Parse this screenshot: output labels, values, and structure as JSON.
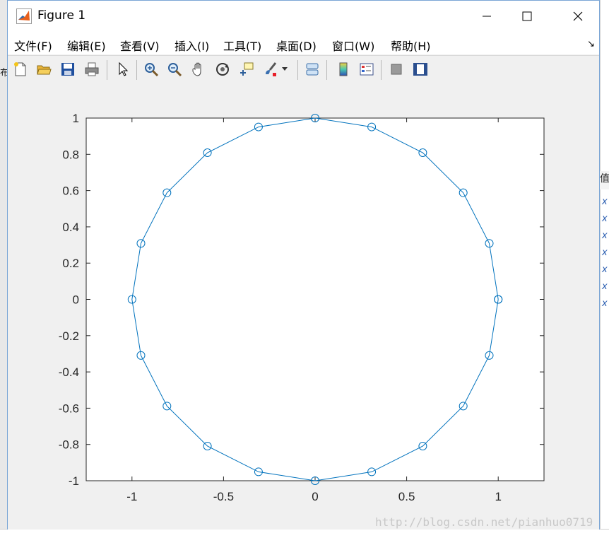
{
  "window": {
    "title": "Figure 1",
    "controls": {
      "minimize_icon": "minimize-icon",
      "maximize_icon": "maximize-icon",
      "close_icon": "close-icon"
    }
  },
  "menu": {
    "items": [
      "文件(F)",
      "编辑(E)",
      "查看(V)",
      "插入(I)",
      "工具(T)",
      "桌面(D)",
      "窗口(W)",
      "帮助(H)"
    ],
    "arrow": "↘"
  },
  "toolbar": {
    "buttons": [
      "new-figure-icon",
      "open-file-icon",
      "save-icon",
      "print-icon",
      "pointer-icon",
      "zoom-in-icon",
      "zoom-out-icon",
      "pan-icon",
      "rotate-3d-icon",
      "data-cursor-icon",
      "brush-icon",
      "link-plot-icon",
      "colorbar-icon",
      "legend-icon",
      "hide-plot-tools-icon",
      "show-plot-tools-icon"
    ]
  },
  "background": {
    "left_chars": "布",
    "right_header": "值",
    "right_rows": [
      "x",
      "x",
      "x",
      "x",
      "x",
      "x",
      "x"
    ]
  },
  "watermark": "http://blog.csdn.net/pianhuo0719",
  "chart_data": {
    "type": "line",
    "marker": "circle",
    "color": "#0072bd",
    "xlim": [
      -1.25,
      1.25
    ],
    "ylim": [
      -1,
      1
    ],
    "xticks": [
      "-1",
      "-0.5",
      "0",
      "0.5",
      "1"
    ],
    "yticks": [
      "-1",
      "-0.8",
      "-0.6",
      "-0.4",
      "-0.2",
      "0",
      "0.2",
      "0.4",
      "0.6",
      "0.8",
      "1"
    ],
    "x": [
      1,
      0.951,
      0.809,
      0.588,
      0.309,
      0,
      -0.309,
      -0.588,
      -0.809,
      -0.951,
      -1,
      -0.951,
      -0.809,
      -0.588,
      -0.309,
      0,
      0.309,
      0.588,
      0.809,
      0.951,
      1
    ],
    "y": [
      0,
      0.309,
      0.588,
      0.809,
      0.951,
      1,
      0.951,
      0.809,
      0.588,
      0.309,
      0,
      -0.309,
      -0.588,
      -0.809,
      -0.951,
      -1,
      -0.951,
      -0.809,
      -0.588,
      -0.309,
      0
    ]
  }
}
